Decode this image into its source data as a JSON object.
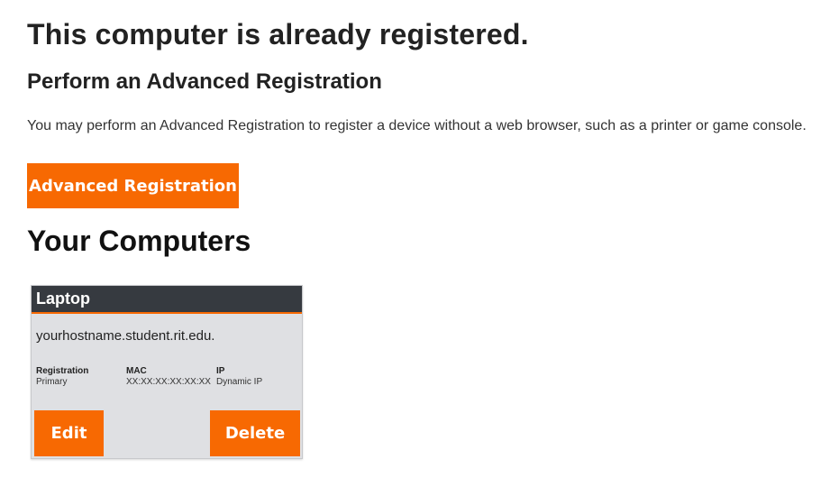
{
  "header": {
    "title": "This computer is already registered.",
    "subtitle": "Perform an Advanced Registration",
    "description": "You may perform an Advanced Registration to register a device without a web browser, such as a printer or game console.",
    "advanced_button_label": "Advanced Registration"
  },
  "computers": {
    "section_title": "Your Computers",
    "items": [
      {
        "name": "Laptop",
        "hostname": "yourhostname.student.rit.edu.",
        "registration_label": "Registration",
        "registration_value": "Primary",
        "mac_label": "MAC",
        "mac_value": "XX:XX:XX:XX:XX:XX",
        "ip_label": "IP",
        "ip_value": "Dynamic IP",
        "edit_label": "Edit",
        "delete_label": "Delete"
      }
    ]
  },
  "colors": {
    "accent": "#f76902",
    "card_header": "#363a40",
    "card_background": "#dfe0e3"
  }
}
